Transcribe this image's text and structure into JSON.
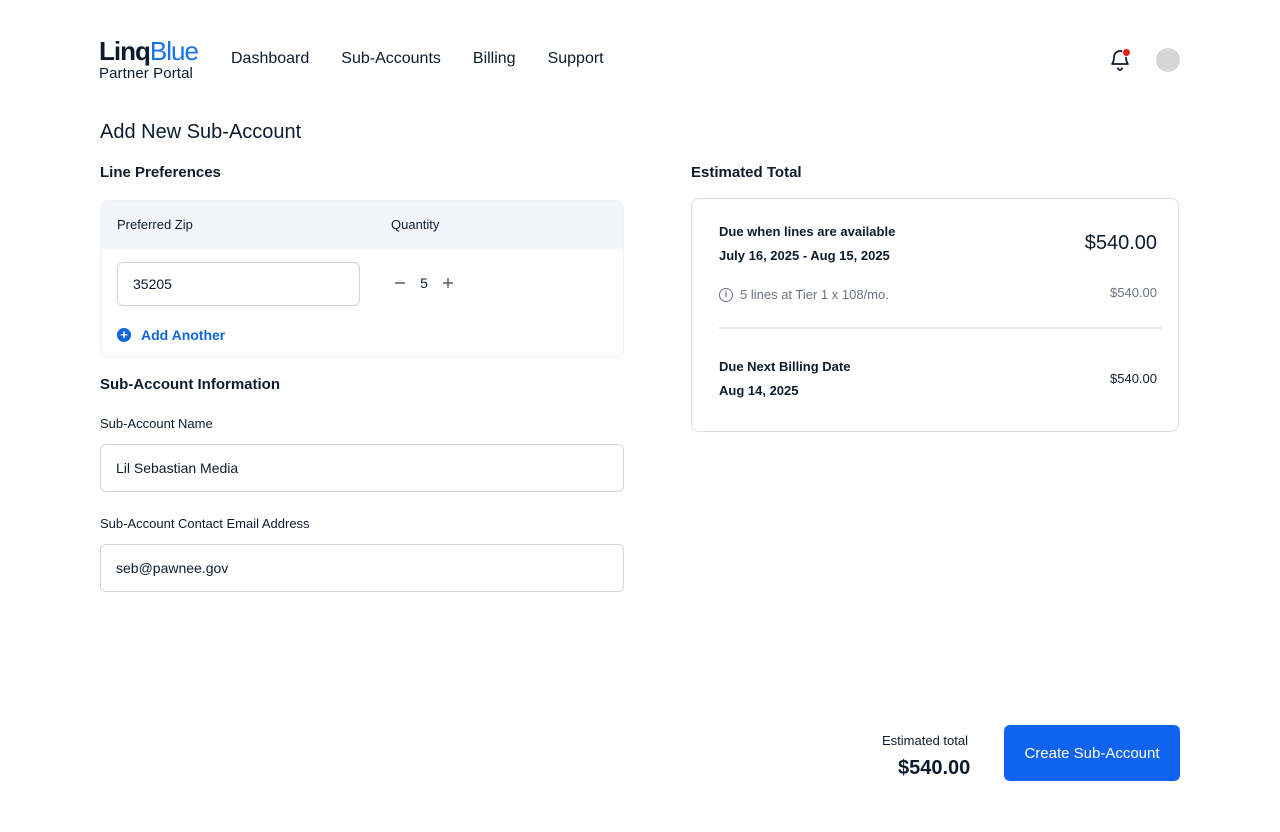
{
  "header": {
    "logo_primary": "Linq",
    "logo_accent": "Blue",
    "logo_subtitle": "Partner Portal",
    "nav": [
      "Dashboard",
      "Sub-Accounts",
      "Billing",
      "Support"
    ],
    "icons": {
      "notifications": "bell-icon",
      "profile": "avatar"
    },
    "notification_dot_color": "#e8201b"
  },
  "page": {
    "title": "Add New Sub-Account"
  },
  "line_preferences": {
    "title": "Line Preferences",
    "col_zip": "Preferred Zip",
    "col_qty": "Quantity",
    "rows": [
      {
        "zip": "35205",
        "quantity": "5"
      }
    ],
    "add_another_label": "Add Another"
  },
  "sub_account": {
    "title": "Sub-Account Information",
    "name_label": "Sub-Account Name",
    "name_value": "Lil Sebastian Media",
    "email_label": "Sub-Account Contact Email Address",
    "email_value": "seb@pawnee.gov"
  },
  "estimate": {
    "title": "Estimated Total",
    "due_available_label": "Due when lines are available",
    "due_available_range": "July 16, 2025 - Aug 15, 2025",
    "due_available_amount": "$540.00",
    "line_detail": "5 lines at Tier 1 x 108/mo.",
    "line_detail_amount": "$540.00",
    "next_billing_label": "Due Next Billing Date",
    "next_billing_date": "Aug 14, 2025",
    "next_billing_amount": "$540.00"
  },
  "footer": {
    "estimated_label": "Estimated total",
    "estimated_amount": "$540.00",
    "create_button": "Create Sub-Account"
  },
  "colors": {
    "accent": "#1273eb",
    "button": "#0f63f0",
    "link": "#1166dd"
  }
}
